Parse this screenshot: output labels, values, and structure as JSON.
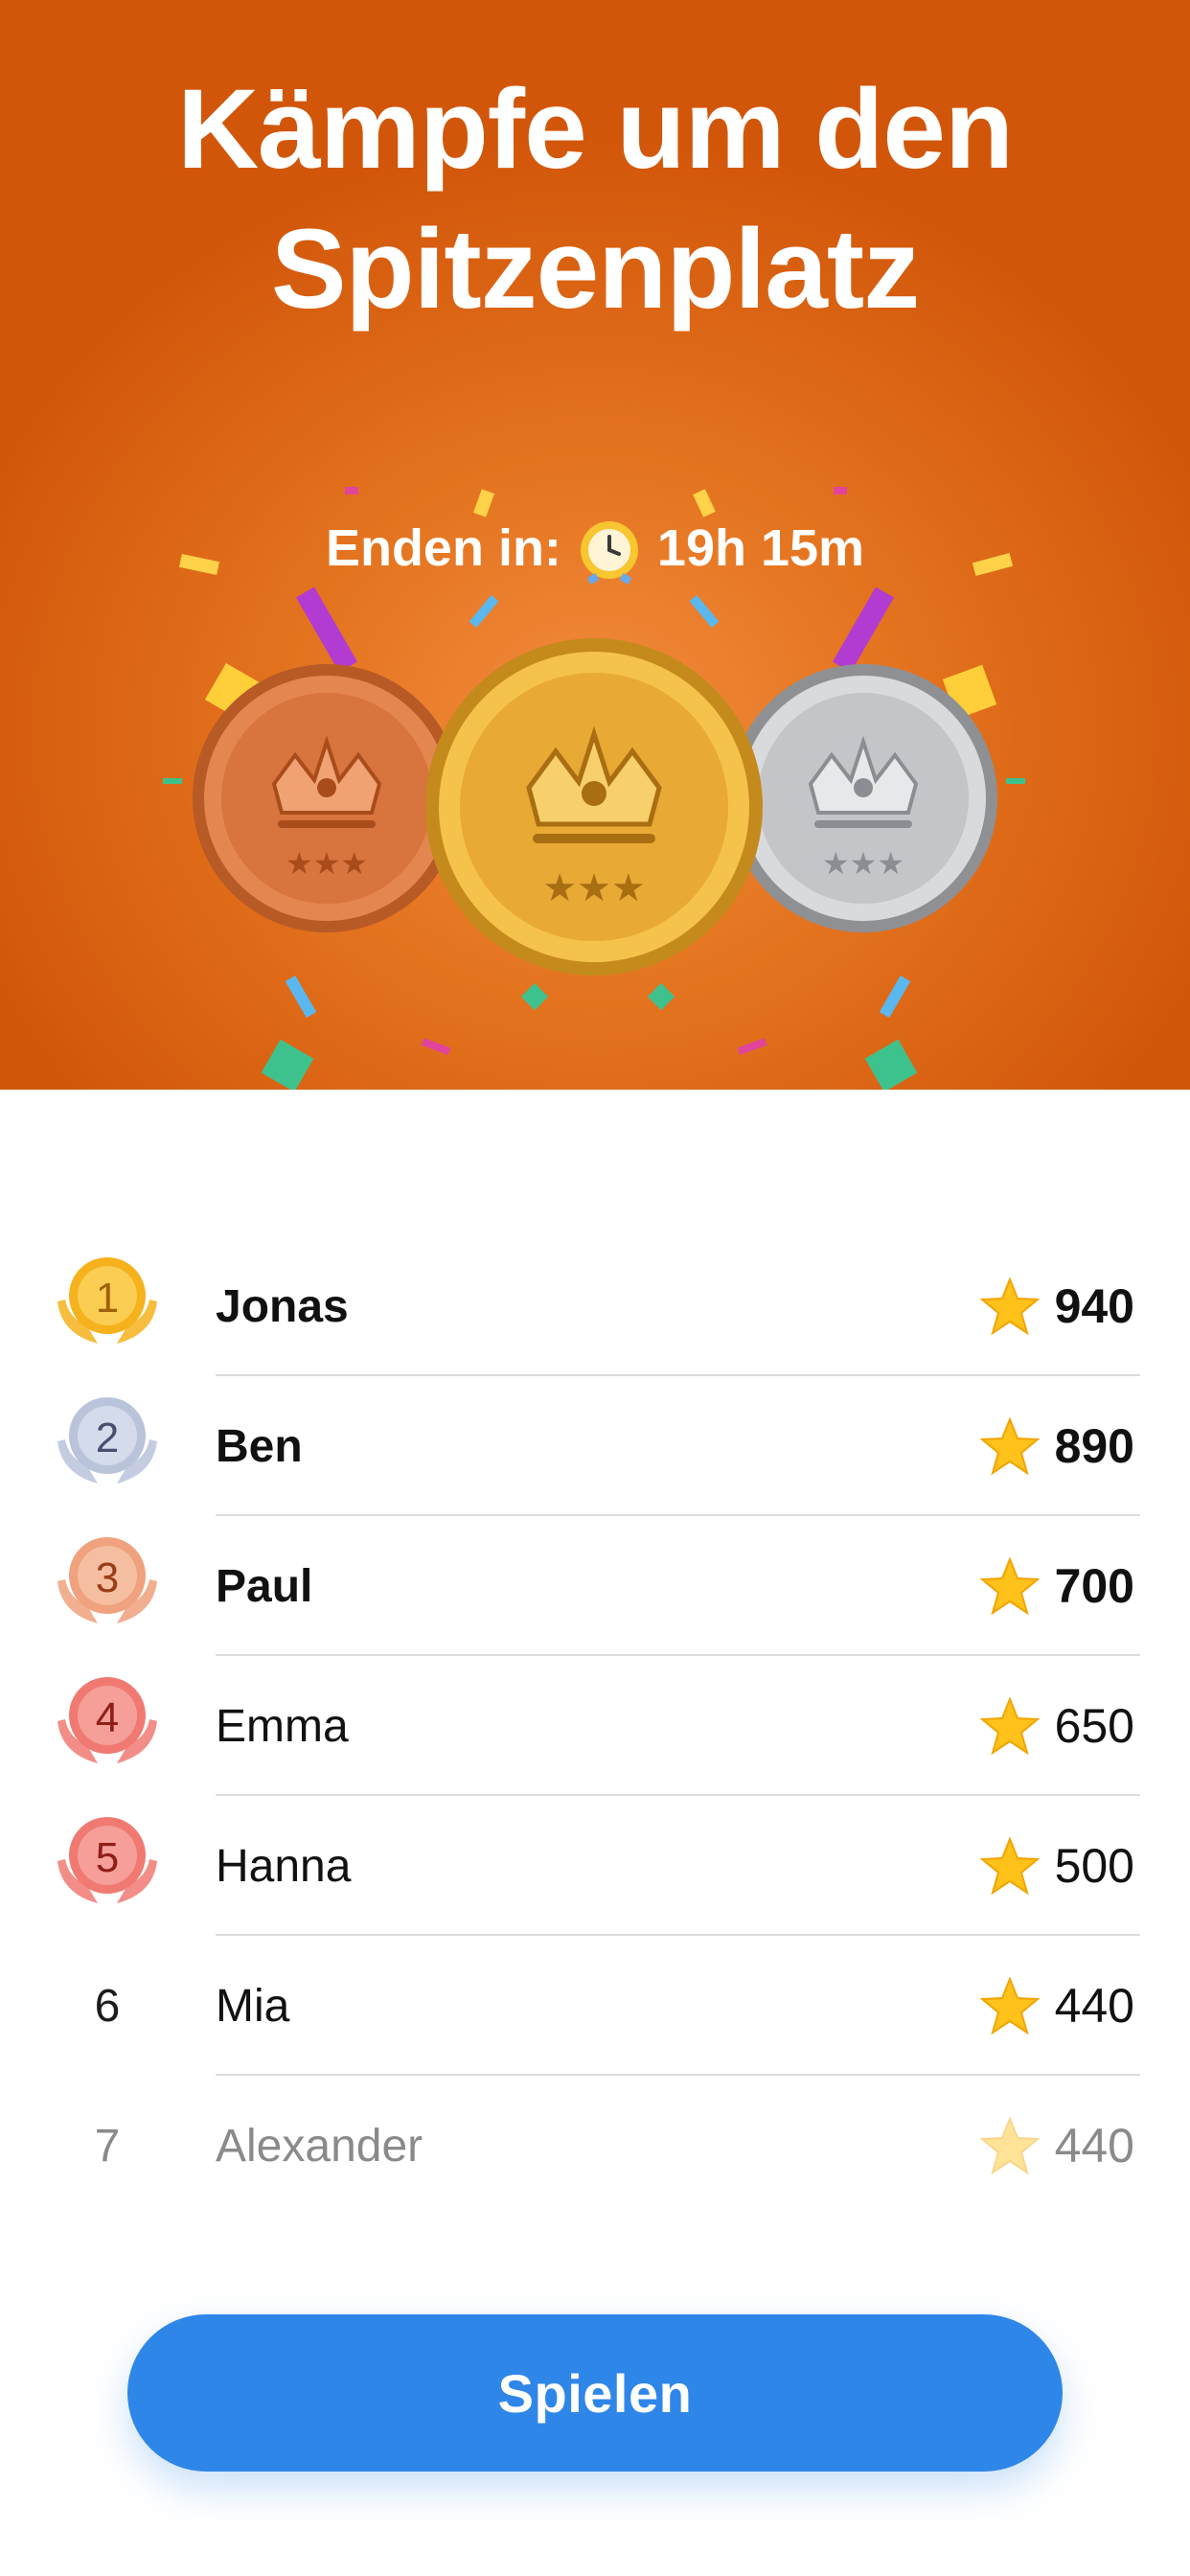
{
  "hero": {
    "title_line1": "Kämpfe um den",
    "title_line2": "Spitzenplatz",
    "timer_label": "Enden in:",
    "timer_icon": "alarm-clock-icon",
    "timer_value": "19h 15m",
    "medals": [
      "bronze-crown-medal",
      "gold-crown-medal",
      "silver-crown-medal"
    ]
  },
  "leaderboard": {
    "rows": [
      {
        "rank": "1",
        "name": "Jonas",
        "score": "940",
        "badge_color": "#f6b21c",
        "badge_text_color": "#a0610b"
      },
      {
        "rank": "2",
        "name": "Ben",
        "score": "890",
        "badge_color": "#b9c3da",
        "badge_text_color": "#46506e"
      },
      {
        "rank": "3",
        "name": "Paul",
        "score": "700",
        "badge_color": "#f0a17d",
        "badge_text_color": "#9a3d16"
      },
      {
        "rank": "4",
        "name": "Emma",
        "score": "650",
        "badge_color": "#f07a72",
        "badge_text_color": "#8f1f18"
      },
      {
        "rank": "5",
        "name": "Hanna",
        "score": "500",
        "badge_color": "#f07a72",
        "badge_text_color": "#8f1f18"
      },
      {
        "rank": "6",
        "name": "Mia",
        "score": "440"
      },
      {
        "rank": "7",
        "name": "Alexander",
        "score": "440"
      }
    ],
    "score_icon": "star-icon"
  },
  "button": {
    "label": "Spielen",
    "color": "#2f86e9"
  },
  "colors": {
    "hero_orange": "#d2560a",
    "accent_blue": "#2f86e9"
  }
}
